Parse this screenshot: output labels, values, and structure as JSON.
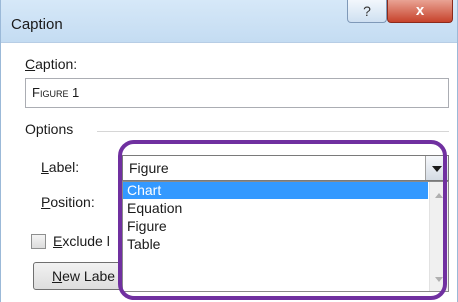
{
  "window": {
    "title": "Caption",
    "help_label": "?",
    "close_label": "x"
  },
  "caption": {
    "label_first": "C",
    "label_rest": "aption:",
    "value": "Figure 1"
  },
  "options": {
    "section_label": "Options",
    "label_field": {
      "label_first": "L",
      "label_rest": "abel:",
      "selected": "Figure"
    },
    "position_field": {
      "label_first": "P",
      "label_rest": "osition:"
    },
    "exclude_label": {
      "label_first": "E",
      "label_rest": "xclude l"
    },
    "new_label_button": {
      "label_first": "N",
      "label_rest": "ew Labe"
    }
  },
  "dropdown": {
    "items": [
      "Chart",
      "Equation",
      "Figure",
      "Table"
    ],
    "highlighted": "Chart"
  },
  "colors": {
    "selection": "#3399ff",
    "highlight_oval": "#7030a0",
    "close_button": "#c7432c",
    "title_bar": "#d6e8f8"
  },
  "icons": {
    "dropdown_arrow": "chevron-down-icon",
    "close": "close-icon",
    "help": "help-icon"
  }
}
